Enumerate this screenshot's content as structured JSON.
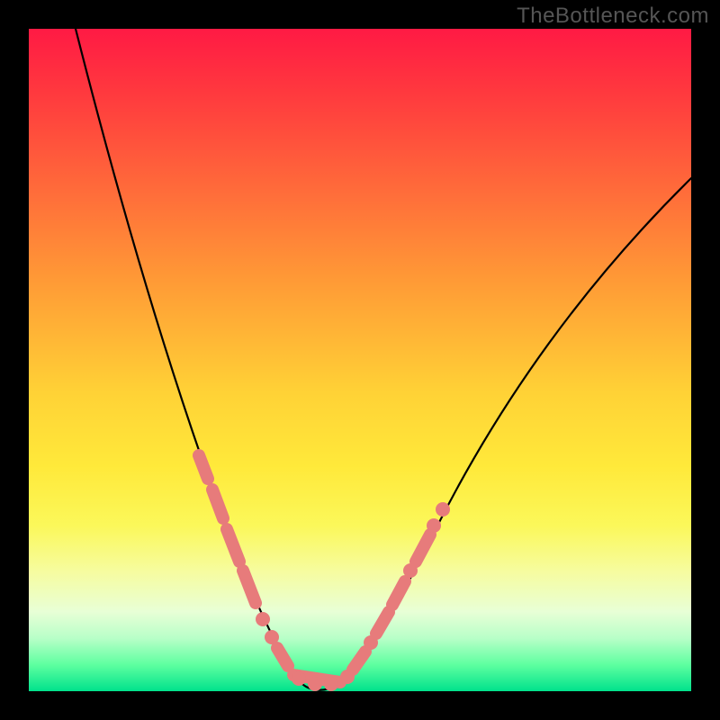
{
  "watermark": "TheBottleneck.com",
  "colors": {
    "frame": "#000000",
    "curve": "#000000",
    "marker": "#e77b7b",
    "gradient_top": "#ff1a44",
    "gradient_bottom": "#00e28c"
  },
  "chart_data": {
    "type": "line",
    "title": "",
    "xlabel": "",
    "ylabel": "",
    "xlim": [
      0,
      100
    ],
    "ylim": [
      0,
      100
    ],
    "x": [
      10,
      12,
      14,
      16,
      18,
      20,
      22,
      24,
      26,
      28,
      30,
      32,
      34,
      36,
      38,
      40,
      42,
      44,
      46,
      48,
      50,
      55,
      60,
      65,
      70,
      75,
      80,
      85,
      90,
      95,
      100
    ],
    "values": [
      100,
      90,
      80,
      70,
      61,
      53,
      45,
      38,
      31,
      25,
      19,
      14,
      10,
      6,
      3,
      1,
      0,
      1,
      3,
      6,
      10,
      20,
      30,
      39,
      47,
      55,
      62,
      68,
      74,
      79,
      83
    ],
    "minimum_x": 42,
    "marker_x_ranges": [
      [
        24,
        36
      ],
      [
        38,
        48
      ],
      [
        48,
        56
      ]
    ],
    "annotations": []
  }
}
